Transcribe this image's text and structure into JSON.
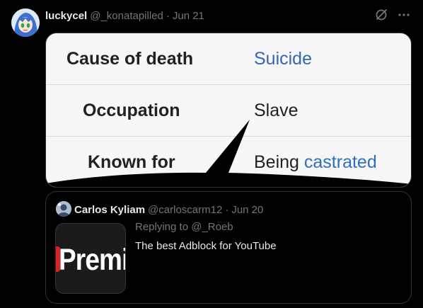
{
  "tweet": {
    "author_name": "luckycel",
    "author_handle": "@_konatapilled",
    "separator": "·",
    "date": "Jun 21",
    "media": {
      "rows": [
        {
          "label": "Cause of death",
          "value": "Suicide"
        },
        {
          "label": "Occupation",
          "value": "Slave"
        },
        {
          "label": "Known for",
          "value_plain": "Being",
          "value_link": "castrated"
        }
      ]
    },
    "quote": {
      "author_name": "Carlos Kyliam",
      "author_handle": "@carloscarm12",
      "separator": "·",
      "date": "Jun 20",
      "reply_prefix": "Replying to",
      "reply_handle": "@_Roeb",
      "text": "The best Adblock for YouTube",
      "thumb_text": "Premi"
    }
  },
  "icons": {
    "grok": "grok-icon",
    "more": "more-icon"
  },
  "colors": {
    "background": "#000000",
    "secondary_text": "#71767b",
    "wiki_link": "#3367b5"
  }
}
